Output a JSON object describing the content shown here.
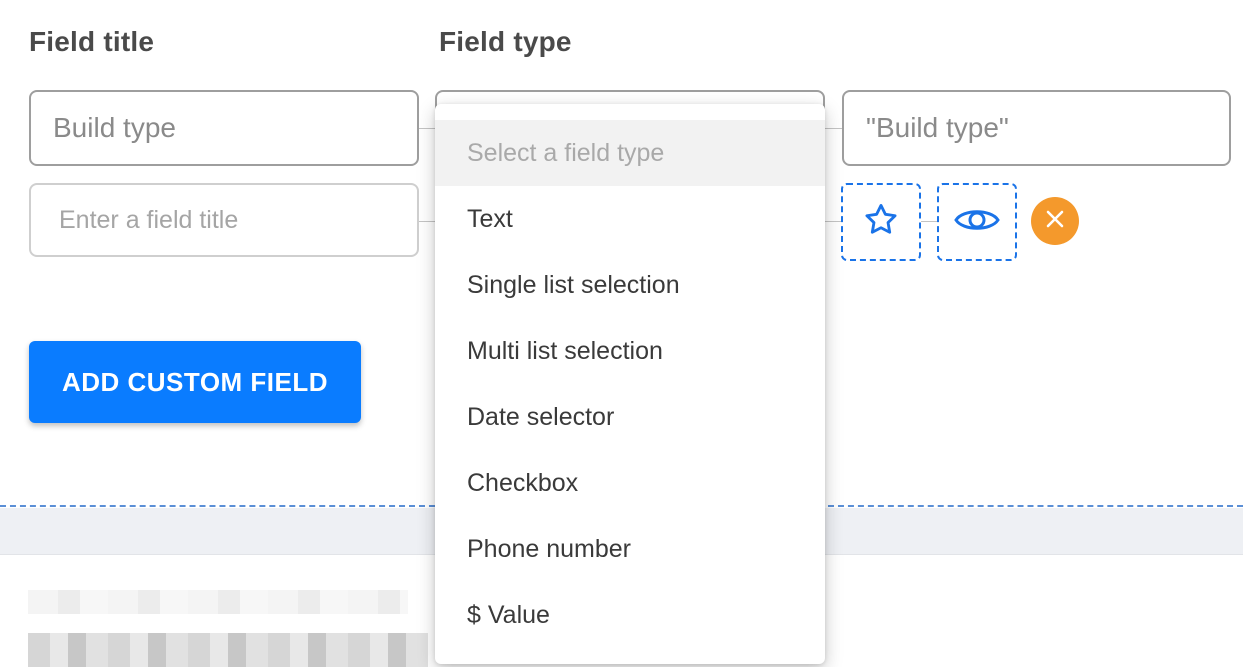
{
  "labels": {
    "field_title": "Field title",
    "field_type": "Field type"
  },
  "row1": {
    "title_value": "Build type",
    "preview_value": "\"Build type\""
  },
  "row2": {
    "title_placeholder": "Enter a field title"
  },
  "dropdown": {
    "options": [
      "Select a field type",
      "Text",
      "Single list selection",
      "Multi list selection",
      "Date selector",
      "Checkbox",
      "Phone number",
      "$ Value"
    ]
  },
  "buttons": {
    "add_custom_field": "ADD CUSTOM FIELD"
  },
  "icons": {
    "favorite": "star-icon",
    "visibility": "eye-icon",
    "remove": "close-icon"
  },
  "colors": {
    "primary": "#0a7cff",
    "icon_blue": "#1a73e8",
    "remove_orange": "#f4992c"
  }
}
